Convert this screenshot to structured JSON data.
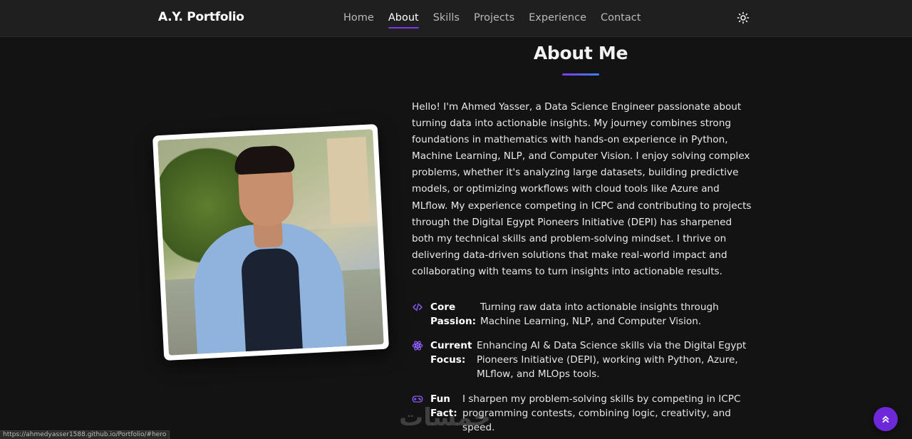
{
  "nav": {
    "brand": "A.Y. Portfolio",
    "links": [
      "Home",
      "About",
      "Skills",
      "Projects",
      "Experience",
      "Contact"
    ],
    "active": "About",
    "theme_toggle_icon": "sun-icon"
  },
  "about": {
    "title": "About Me",
    "intro": "Hello! I'm Ahmed Yasser, a Data Science Engineer passionate about turning data into actionable insights. My journey combines strong foundations in mathematics with hands-on experience in Python, Machine Learning, NLP, and Computer Vision. I enjoy solving complex problems, whether it's analyzing large datasets, building predictive models, or optimizing workflows with cloud tools like Azure and MLflow. My experience competing in ICPC and contributing to projects through the Digital Egypt Pioneers Initiative (DEPI) has sharpened both my technical skills and problem-solving mindset. I thrive on delivering data-driven solutions that make real-world impact and collaborating with teams to turn insights into actionable results.",
    "features": [
      {
        "icon": "code-icon",
        "label": "Core Passion:",
        "text": "Turning raw data into actionable insights through Machine Learning, NLP, and Computer Vision."
      },
      {
        "icon": "atom-icon",
        "label": "Current Focus:",
        "text": "Enhancing AI & Data Science skills via the Digital Egypt Pioneers Initiative (DEPI), working with Python, Azure, MLflow, and MLOps tools."
      },
      {
        "icon": "gamepad-icon",
        "label": "Fun Fact:",
        "text": "I sharpen my problem-solving skills by competing in ICPC programming contests, combining logic, creativity, and speed."
      }
    ]
  },
  "scroll_top_icon": "chevrons-up-icon",
  "status_bar_url": "https://ahmedyasser1588.github.io/Portfolio/#hero",
  "watermark_text": "خمسات",
  "colors": {
    "background": "#131313",
    "navbar": "#1f1f1f",
    "accent": "#7c3aed",
    "accent_secondary": "#3b82f6"
  }
}
